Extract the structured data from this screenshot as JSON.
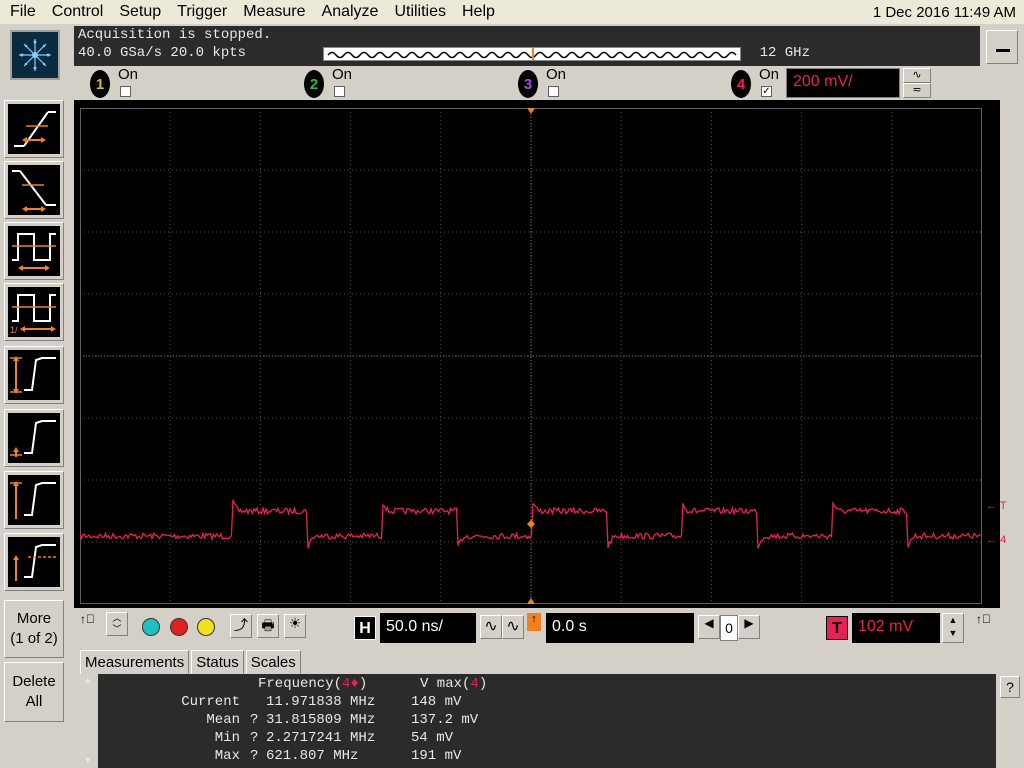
{
  "menu": [
    "File",
    "Control",
    "Setup",
    "Trigger",
    "Measure",
    "Analyze",
    "Utilities",
    "Help"
  ],
  "clock": "1 Dec 2016 11:49 AM",
  "status": {
    "line1": "Acquisition is stopped.",
    "line2": "40.0 GSa/s   20.0 kpts",
    "bandwidth": "12 GHz"
  },
  "channels": [
    {
      "num": "1",
      "label": "On",
      "checked": false,
      "color": "#d8c020"
    },
    {
      "num": "2",
      "label": "On",
      "checked": false,
      "color": "#20c040"
    },
    {
      "num": "3",
      "label": "On",
      "checked": false,
      "color": "#a050e0"
    },
    {
      "num": "4",
      "label": "On",
      "checked": true,
      "color": "#e8205a"
    }
  ],
  "ch4_scale": "200 mV/",
  "left_buttons": {
    "more_line1": "More",
    "more_line2": "(1 of 2)",
    "delete_line1": "Delete",
    "delete_line2": "All"
  },
  "horizontal": {
    "h_label": "H",
    "timebase": "50.0 ns/",
    "delay": "0.0 s",
    "ref": "0"
  },
  "trigger": {
    "t_label": "T",
    "level": "102 mV"
  },
  "tabs": [
    "Measurements",
    "Status",
    "Scales"
  ],
  "measurements": {
    "col1": "Frequency(",
    "col1_ch": "4♦",
    "col2": "V max(",
    "col2_ch": "4",
    "rows": [
      {
        "label": "Current",
        "q": "",
        "freq": "11.971838 MHz",
        "vmax": "148 mV"
      },
      {
        "label": "Mean",
        "q": "?",
        "freq": "31.815809 MHz",
        "vmax": "137.2 mV"
      },
      {
        "label": "Min",
        "q": "?",
        "freq": "2.2717241 MHz",
        "vmax": "54 mV"
      },
      {
        "label": "Max",
        "q": "?",
        "freq": "621.807 MHz",
        "vmax": "191 mV"
      }
    ]
  },
  "markers": {
    "trig_right": "T",
    "ch4_right": "4"
  },
  "trace_color": "#e8205a",
  "help_q": "?"
}
